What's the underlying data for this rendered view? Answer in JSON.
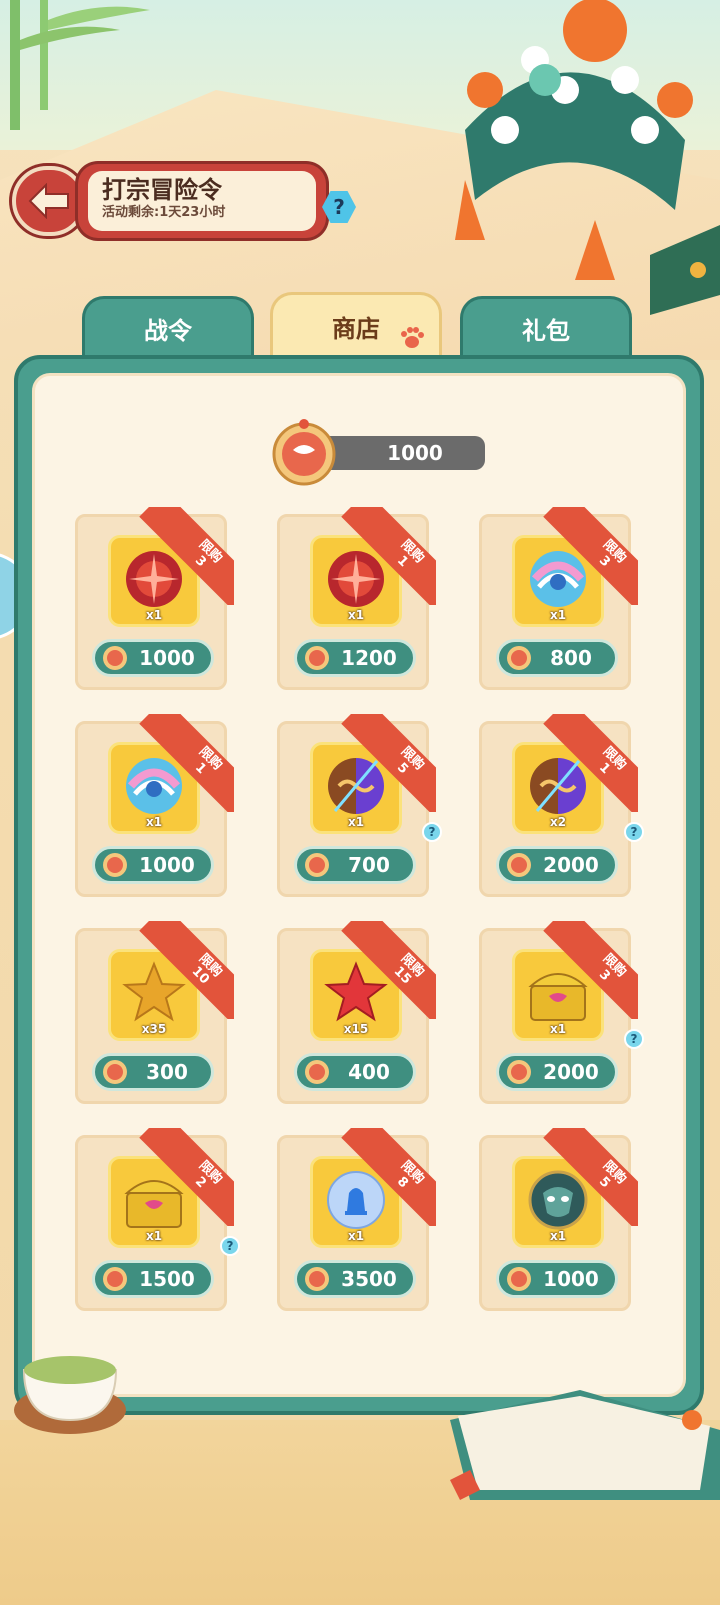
{
  "header": {
    "title": "打宗冒险令",
    "subtitle": "活动剩余:1天23小时",
    "back_icon": "back-arrow-icon",
    "help_label": "?"
  },
  "tabs": [
    {
      "label": "战令",
      "active": false
    },
    {
      "label": "商店",
      "active": true
    },
    {
      "label": "礼包",
      "active": false
    }
  ],
  "currency": {
    "amount": "1000",
    "icon": "opera-mask-coin-icon"
  },
  "shop": {
    "limit_label": "限购",
    "items": [
      {
        "icon": "red-orb-icon",
        "qty": "x1",
        "limit": "3",
        "price": "1000",
        "info": false
      },
      {
        "icon": "red-orb-icon",
        "qty": "x1",
        "limit": "1",
        "price": "1200",
        "info": false
      },
      {
        "icon": "rainbow-orb-icon",
        "qty": "x1",
        "limit": "3",
        "price": "800",
        "info": false
      },
      {
        "icon": "rainbow-orb-icon",
        "qty": "x1",
        "limit": "1",
        "price": "1000",
        "info": false
      },
      {
        "icon": "split-orb-icon",
        "qty": "x1",
        "limit": "5",
        "price": "700",
        "info": true
      },
      {
        "icon": "split-orb-icon",
        "qty": "x2",
        "limit": "1",
        "price": "2000",
        "info": true
      },
      {
        "icon": "gold-star-icon",
        "qty": "x35",
        "limit": "10",
        "price": "300",
        "info": false
      },
      {
        "icon": "red-star-icon",
        "qty": "x15",
        "limit": "15",
        "price": "400",
        "info": false
      },
      {
        "icon": "treasure-chest-icon",
        "qty": "x1",
        "limit": "3",
        "price": "2000",
        "info": true
      },
      {
        "icon": "treasure-chest-icon",
        "qty": "x1",
        "limit": "2",
        "price": "1500",
        "info": true
      },
      {
        "icon": "blue-bell-orb-icon",
        "qty": "x1",
        "limit": "8",
        "price": "3500",
        "info": false
      },
      {
        "icon": "mask-orb-icon",
        "qty": "x1",
        "limit": "5",
        "price": "1000",
        "info": false
      }
    ]
  },
  "colors": {
    "panel_teal": "#4a9e8e",
    "ribbon_red": "#e2543b",
    "item_yellow": "#f8c93c",
    "title_red": "#c8433a"
  }
}
